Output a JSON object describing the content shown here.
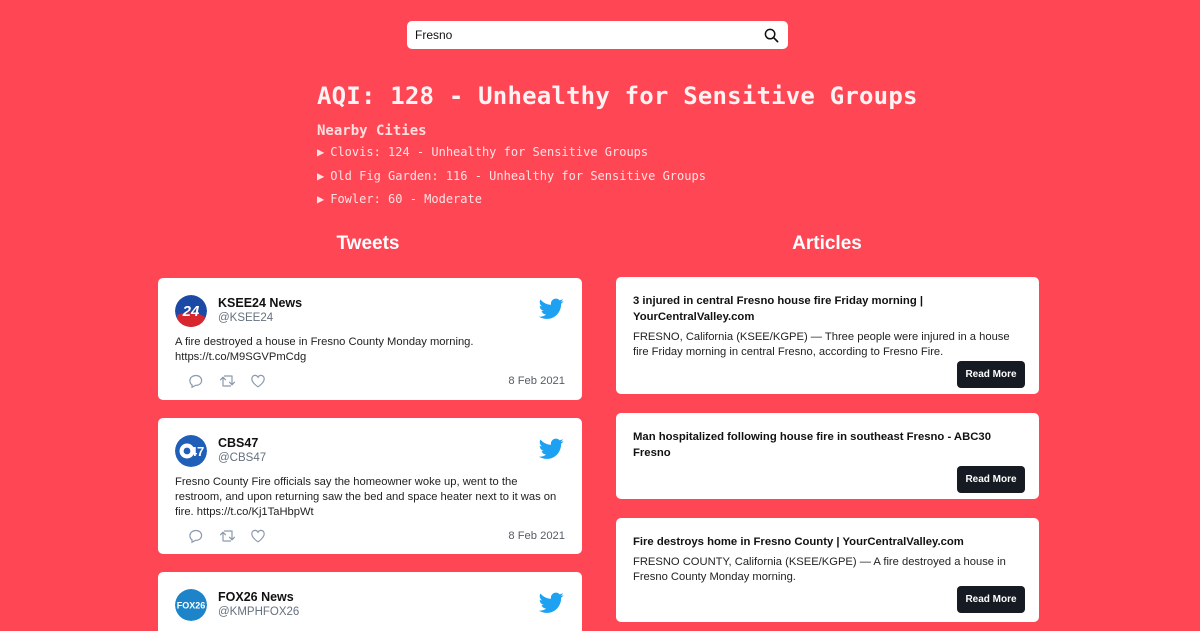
{
  "search": {
    "value": "Fresno"
  },
  "aqi": {
    "title": "AQI: 128 - Unhealthy for Sensitive Groups"
  },
  "nearby": {
    "heading": "Nearby Cities",
    "items": [
      {
        "label": "Clovis: 124 - Unhealthy for Sensitive Groups"
      },
      {
        "label": "Old Fig Garden: 116 - Unhealthy for Sensitive Groups"
      },
      {
        "label": "Fowler: 60 - Moderate"
      }
    ]
  },
  "tweets": {
    "heading": "Tweets",
    "items": [
      {
        "name": "KSEE24 News",
        "handle": "@KSEE24",
        "avatar_text": "24",
        "avatar_color": "#1b4aa6",
        "text": "A fire destroyed a house in Fresno County Monday morning. https://t.co/M9SGVPmCdg",
        "date": "8 Feb 2021"
      },
      {
        "name": "CBS47",
        "handle": "@CBS47",
        "avatar_text": "47",
        "avatar_color": "#1f5fb8",
        "text": "Fresno County Fire officials say the homeowner woke up, went to the restroom, and upon returning saw the bed and space heater next to it was on fire. https://t.co/Kj1TaHbpWt",
        "date": "8 Feb 2021"
      },
      {
        "name": "FOX26 News",
        "handle": "@KMPHFOX26",
        "avatar_text": "FOX26",
        "avatar_color": "#1d84c9",
        "text": "",
        "date": ""
      }
    ]
  },
  "articles": {
    "heading": "Articles",
    "read_more_label": "Read More",
    "items": [
      {
        "title": "3 injured in central Fresno house fire Friday morning | YourCentralValley.com",
        "description": "FRESNO, California (KSEE/KGPE) — Three people were injured in a house fire Friday morning in central Fresno, according to Fresno Fire."
      },
      {
        "title": "Man hospitalized following house fire in southeast Fresno - ABC30 Fresno",
        "description": ""
      },
      {
        "title": "Fire destroys home in Fresno County | YourCentralValley.com",
        "description": "FRESNO COUNTY, California (KSEE/KGPE) — A fire destroyed a house in Fresno County Monday morning."
      }
    ]
  },
  "icons": {
    "search": "search-icon",
    "twitter": "twitter-bird-icon",
    "reply": "reply-icon",
    "retweet": "retweet-icon",
    "like": "heart-icon",
    "expand": "triangle-right-icon"
  },
  "colors": {
    "background": "#ff4655",
    "twitter_blue": "#1da1f2",
    "button_dark": "#161a22"
  }
}
